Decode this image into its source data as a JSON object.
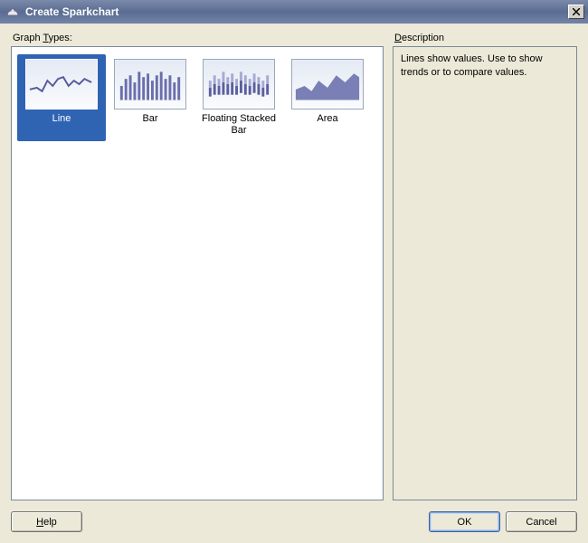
{
  "window": {
    "title": "Create  Sparkchart"
  },
  "sections": {
    "graph_types": {
      "label_pre": "Graph ",
      "accel": "T",
      "label_post": "ypes:"
    },
    "description": {
      "accel": "D",
      "label_post": "escription"
    }
  },
  "graph_types": {
    "items": [
      {
        "id": "line",
        "label": "Line",
        "selected": true
      },
      {
        "id": "bar",
        "label": "Bar",
        "selected": false
      },
      {
        "id": "fsb",
        "label": "Floating Stacked Bar",
        "selected": false
      },
      {
        "id": "area",
        "label": "Area",
        "selected": false
      }
    ]
  },
  "description": {
    "text": "Lines show values. Use to show trends or to compare values."
  },
  "buttons": {
    "help_accel": "H",
    "help_post": "elp",
    "ok": "OK",
    "cancel": "Cancel"
  }
}
